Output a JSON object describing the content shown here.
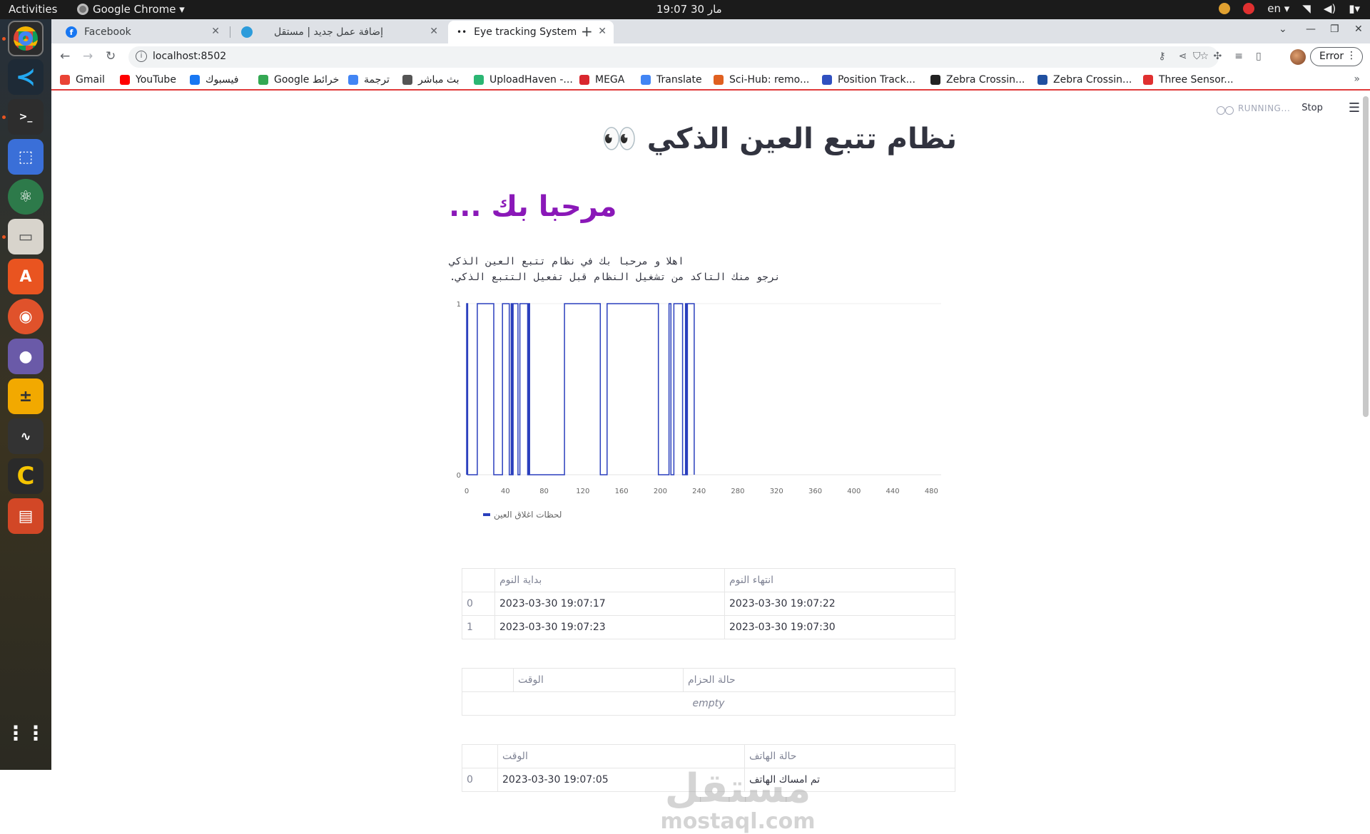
{
  "desktop": {
    "activities": "Activities",
    "app_menu": "Google Chrome ▾",
    "clock": "19:07  30 مار",
    "lang": "en ▾"
  },
  "tabs": [
    {
      "label": "Facebook",
      "icon": "facebook-icon",
      "color": "#1877f2"
    },
    {
      "label": "إضافة عمل جديد | مستقل",
      "icon": "mostaql-icon",
      "color": "#2d9cdb"
    },
    {
      "label": "Eye tracking System",
      "icon": "eyes-icon",
      "color": "#444444"
    }
  ],
  "toolbar": {
    "url": "localhost:8502",
    "error_label": "Error"
  },
  "bookmarks": [
    {
      "label": "Gmail",
      "icon": "gmail-icon",
      "color": "#ea4335"
    },
    {
      "label": "YouTube",
      "icon": "youtube-icon",
      "color": "#ff0000"
    },
    {
      "label": "فيسبوك",
      "icon": "facebook-icon",
      "color": "#1877f2"
    },
    {
      "label": "Google خرائط",
      "icon": "maps-icon",
      "color": "#34a853"
    },
    {
      "label": "ترجمة",
      "icon": "translate-icon",
      "color": "#4285f4"
    },
    {
      "label": "بث مباشر",
      "icon": "live-icon",
      "color": "#555555"
    },
    {
      "label": "UploadHaven -...",
      "icon": "uploadhaven-icon",
      "color": "#2bb673"
    },
    {
      "label": "MEGA",
      "icon": "mega-icon",
      "color": "#d9272e"
    },
    {
      "label": "Translate",
      "icon": "translate-icon",
      "color": "#4285f4"
    },
    {
      "label": "Sci-Hub: remo...",
      "icon": "scihub-icon",
      "color": "#e06020"
    },
    {
      "label": "Position Track...",
      "icon": "position-icon",
      "color": "#3050c0"
    },
    {
      "label": "Zebra Crossin...",
      "icon": "zebra-icon",
      "color": "#222222"
    },
    {
      "label": "Zebra Crossin...",
      "icon": "zebra2-icon",
      "color": "#2050a0"
    },
    {
      "label": "Three Sensor...",
      "icon": "sensor-icon",
      "color": "#e03030"
    }
  ],
  "app": {
    "status": "RUNNING...",
    "stop": "Stop",
    "title": "نظام تتبع العين الذكي 👀",
    "welcome": "مرحبا بك ...",
    "intro_line1": "اهلا و مرحبا بك في نظام تتبع العين الذكي",
    "intro_line2": "نرجو منك التاكد من تشغيل النظام قبل تفعيل التتبع الذكي."
  },
  "chart_data": {
    "type": "line",
    "series": [
      {
        "name": "لحظات اغلاق العين",
        "color": "#2a3fbd",
        "values": [
          [
            0,
            0
          ],
          [
            0,
            1
          ],
          [
            1,
            1
          ],
          [
            1,
            0
          ],
          [
            11,
            0
          ],
          [
            11,
            1
          ],
          [
            28,
            1
          ],
          [
            28,
            0
          ],
          [
            37,
            0
          ],
          [
            37,
            1
          ],
          [
            44,
            1
          ],
          [
            44,
            0
          ],
          [
            46,
            0
          ],
          [
            46,
            1
          ],
          [
            47,
            1
          ],
          [
            47,
            0
          ],
          [
            48,
            0
          ],
          [
            48,
            1
          ],
          [
            53,
            1
          ],
          [
            53,
            0
          ],
          [
            55,
            0
          ],
          [
            55,
            1
          ],
          [
            63,
            1
          ],
          [
            63,
            0
          ],
          [
            64,
            0
          ],
          [
            64,
            1
          ],
          [
            65,
            1
          ],
          [
            65,
            0
          ],
          [
            101,
            0
          ],
          [
            101,
            1
          ],
          [
            138,
            1
          ],
          [
            138,
            0
          ],
          [
            145,
            0
          ],
          [
            145,
            1
          ],
          [
            198,
            1
          ],
          [
            198,
            0
          ],
          [
            209,
            0
          ],
          [
            209,
            1
          ],
          [
            211,
            1
          ],
          [
            211,
            0
          ],
          [
            214,
            0
          ],
          [
            214,
            1
          ],
          [
            223,
            1
          ],
          [
            223,
            0
          ],
          [
            226,
            0
          ],
          [
            226,
            1
          ],
          [
            227,
            1
          ],
          [
            227,
            0
          ],
          [
            228,
            0
          ],
          [
            228,
            1
          ],
          [
            235,
            1
          ],
          [
            235,
            0
          ]
        ]
      }
    ],
    "x_ticks": [
      0,
      40,
      80,
      120,
      160,
      200,
      240,
      280,
      320,
      360,
      400,
      440,
      480
    ],
    "y_ticks": [
      0,
      1
    ],
    "xlim": [
      0,
      500
    ],
    "ylim": [
      0,
      1
    ],
    "legend": "bottom-left"
  },
  "tables": {
    "sleep": {
      "columns": [
        "",
        "بداية النوم",
        "انتهاء النوم"
      ],
      "rows": [
        [
          "0",
          "2023-03-30 19:07:17",
          "2023-03-30 19:07:22"
        ],
        [
          "1",
          "2023-03-30 19:07:23",
          "2023-03-30 19:07:30"
        ]
      ]
    },
    "belt": {
      "columns": [
        "",
        "الوقت",
        "حالة الحزام"
      ],
      "empty": "empty"
    },
    "phone": {
      "columns": [
        "",
        "الوقت",
        "حالة الهاتف"
      ],
      "rows": [
        [
          "0",
          "2023-03-30 19:07:05",
          "تم امساك الهاتف"
        ]
      ]
    }
  },
  "watermark": {
    "arabic": "مستقل",
    "latin": "mostaql.com"
  }
}
